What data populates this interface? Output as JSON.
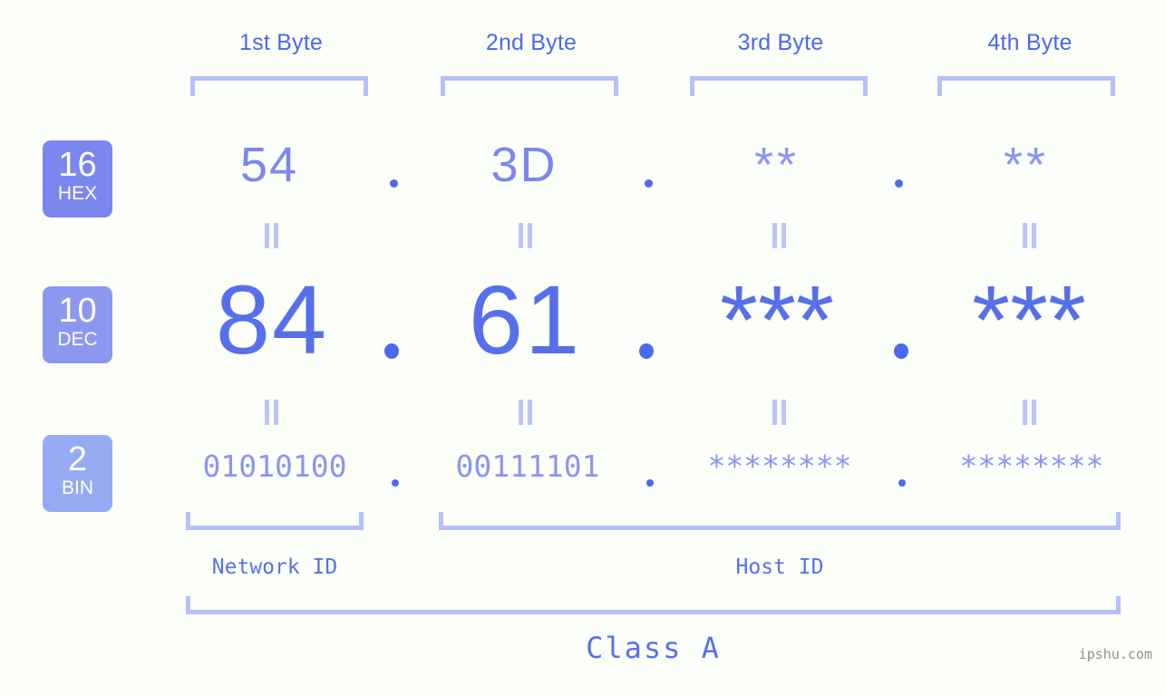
{
  "diagram": {
    "title": "IP address byte breakdown",
    "background_color": "#fdfffb",
    "accent_color": "#4c68ee",
    "light_accent_color": "#b6c0fb",
    "byte_headers": [
      {
        "label": "1st Byte"
      },
      {
        "label": "2nd Byte"
      },
      {
        "label": "3rd Byte"
      },
      {
        "label": "4th Byte"
      }
    ],
    "bases": [
      {
        "num": "16",
        "name": "HEX",
        "badge_color": "#7b86ee"
      },
      {
        "num": "10",
        "name": "DEC",
        "badge_color": "#8c97f0"
      },
      {
        "num": "2",
        "name": "BIN",
        "badge_color": "#96aaf4"
      }
    ],
    "rows": {
      "hex": {
        "base": "16",
        "base_name": "HEX",
        "values": [
          "54",
          "3D",
          "**",
          "**"
        ]
      },
      "dec": {
        "base": "10",
        "base_name": "DEC",
        "values": [
          "84",
          "61",
          "***",
          "***"
        ]
      },
      "bin": {
        "base": "2",
        "base_name": "BIN",
        "values": [
          "01010100",
          "00111101",
          "********",
          "********"
        ]
      }
    },
    "separator": ".",
    "equality_mark": "=",
    "segments": {
      "network_id_label": "Network ID",
      "host_id_label": "Host ID",
      "class_label": "Class A"
    },
    "watermark": "ipshu.com"
  }
}
